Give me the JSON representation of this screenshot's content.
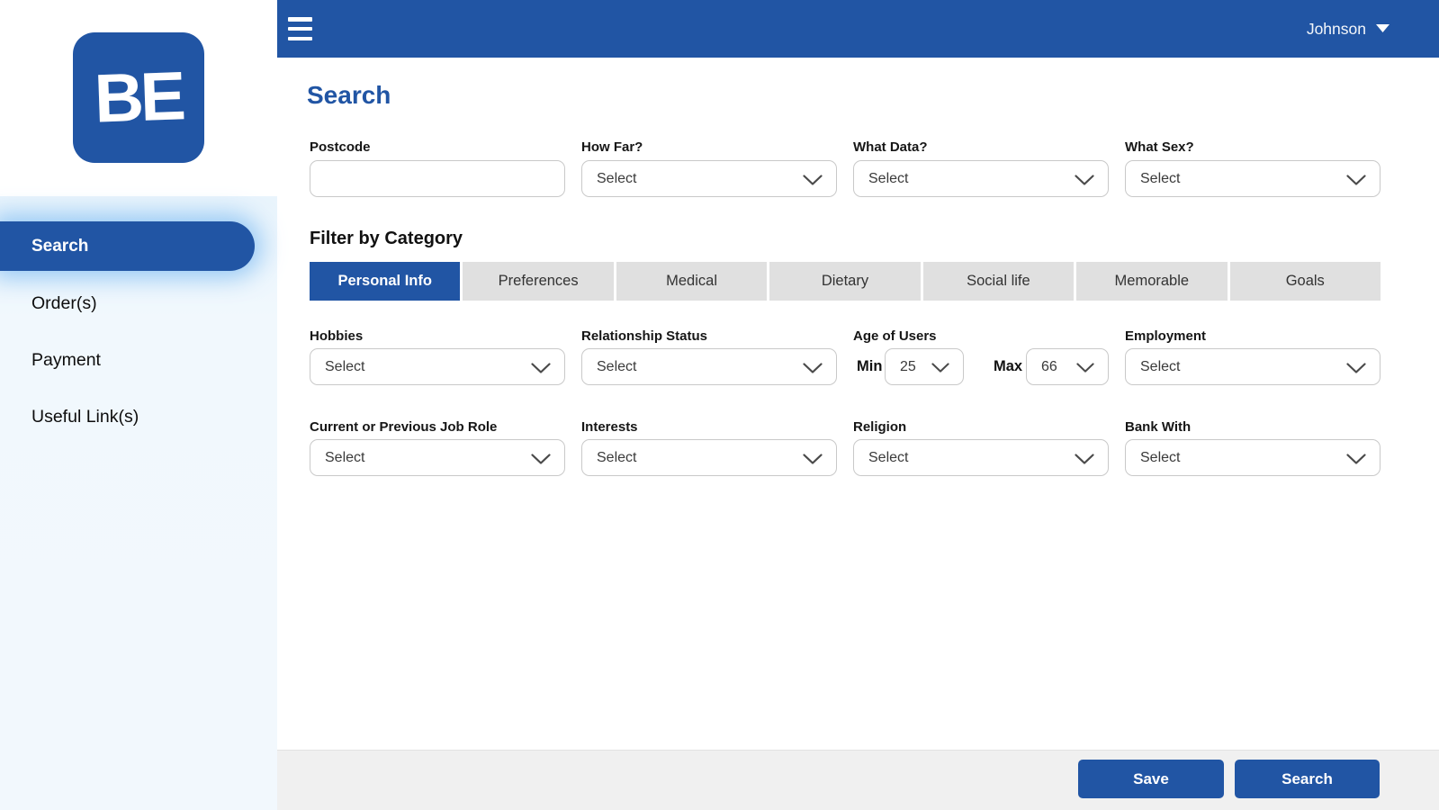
{
  "colors": {
    "primary_blue": "#2155A4",
    "sidebar_tint": "#F1F8FD",
    "tab_inactive_bg": "#E0E0E0",
    "footer_bg": "#F0F0F0"
  },
  "topbar": {
    "user_name": "Johnson"
  },
  "sidebar": {
    "logo_text": "BE",
    "items": [
      {
        "label": "Search",
        "active": true
      },
      {
        "label": "Order(s)",
        "active": false
      },
      {
        "label": "Payment",
        "active": false
      },
      {
        "label": "Useful Link(s)",
        "active": false
      }
    ]
  },
  "main": {
    "title": "Search",
    "row1": [
      {
        "label": "Postcode",
        "type": "text",
        "value": "",
        "placeholder": ""
      },
      {
        "label": "How Far?",
        "type": "select",
        "value": "Select"
      },
      {
        "label": "What Data?",
        "type": "select",
        "value": "Select"
      },
      {
        "label": "What Sex?",
        "type": "select",
        "value": "Select"
      }
    ],
    "filter": {
      "heading": "Filter by Category",
      "tabs": [
        {
          "label": "Personal Info",
          "active": true
        },
        {
          "label": "Preferences",
          "active": false
        },
        {
          "label": "Medical",
          "active": false
        },
        {
          "label": "Dietary",
          "active": false
        },
        {
          "label": "Social life",
          "active": false
        },
        {
          "label": "Memorable",
          "active": false
        },
        {
          "label": "Goals",
          "active": false
        }
      ]
    },
    "row2": [
      {
        "label": "Hobbies",
        "type": "select",
        "value": "Select"
      },
      {
        "label": "Relationship Status",
        "type": "select",
        "value": "Select"
      },
      {
        "label": "Age of Users",
        "type": "age-range",
        "min_label": "Min",
        "min_value": "25",
        "max_label": "Max",
        "max_value": "66"
      },
      {
        "label": "Employment",
        "type": "select",
        "value": "Select"
      }
    ],
    "row3": [
      {
        "label": "Current or Previous Job Role",
        "type": "select",
        "value": "Select"
      },
      {
        "label": "Interests",
        "type": "select",
        "value": "Select"
      },
      {
        "label": "Religion",
        "type": "select",
        "value": "Select"
      },
      {
        "label": "Bank With",
        "type": "select",
        "value": "Select"
      }
    ]
  },
  "footer": {
    "save_label": "Save",
    "search_label": "Search"
  }
}
